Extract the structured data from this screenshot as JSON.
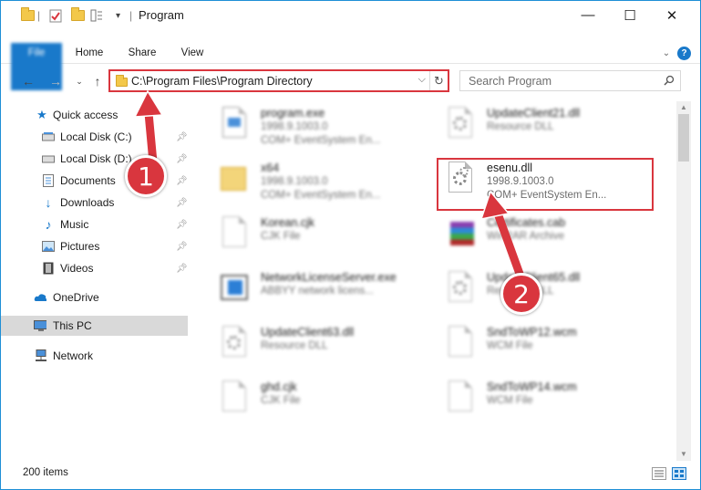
{
  "window": {
    "title": "Program",
    "controls": {
      "minimize": "—",
      "maximize": "☐",
      "close": "✕"
    }
  },
  "ribbon": {
    "tabs": [
      {
        "label": "File"
      },
      {
        "label": "Home"
      },
      {
        "label": "Share"
      },
      {
        "label": "View"
      }
    ],
    "help": "?"
  },
  "address": {
    "path": "C:\\Program Files\\Program Directory",
    "refresh": "↻",
    "dropdown": "⌵"
  },
  "search": {
    "placeholder": "Search Program"
  },
  "sidebar": {
    "items": [
      {
        "label": "Quick access",
        "icon": "star-icon",
        "pinned": false
      },
      {
        "label": "Local Disk (C:)",
        "icon": "disk-icon",
        "pinned": true
      },
      {
        "label": "Local Disk (D:)",
        "icon": "disk-icon",
        "pinned": true
      },
      {
        "label": "Documents",
        "icon": "documents-icon",
        "pinned": true
      },
      {
        "label": "Downloads",
        "icon": "download-icon",
        "pinned": true
      },
      {
        "label": "Music",
        "icon": "music-icon",
        "pinned": true
      },
      {
        "label": "Pictures",
        "icon": "pictures-icon",
        "pinned": true
      },
      {
        "label": "Videos",
        "icon": "videos-icon",
        "pinned": true
      },
      {
        "label": "OneDrive",
        "icon": "cloud-icon",
        "pinned": false
      },
      {
        "label": "This PC",
        "icon": "computer-icon",
        "pinned": false,
        "selected": true
      },
      {
        "label": "Network",
        "icon": "network-icon",
        "pinned": false
      }
    ]
  },
  "files": [
    {
      "name": "program.exe",
      "line1": "1998.9.1003.0",
      "line2": "COM+ EventSystem En...",
      "type": "exe"
    },
    {
      "name": "UpdateClient21.dll",
      "line1": "Resource DLL",
      "line2": "",
      "type": "dll"
    },
    {
      "name": "x64",
      "line1": "1998.9.1003.0",
      "line2": "COM+ EventSystem En...",
      "type": "folder"
    },
    {
      "name": "esenu.dll",
      "line1": "1998.9.1003.0",
      "line2": "COM+ EventSystem En...",
      "type": "dll",
      "highlighted": true
    },
    {
      "name": "Korean.cjk",
      "line1": "CJK File",
      "line2": "",
      "type": "blank"
    },
    {
      "name": "Certificates.cab",
      "line1": "WinRAR Archive",
      "line2": "",
      "type": "archive"
    },
    {
      "name": "NetworkLicenseServer.exe",
      "line1": "ABBYY network licens...",
      "line2": "",
      "type": "app"
    },
    {
      "name": "UpdateClient65.dll",
      "line1": "Resource DLL",
      "line2": "",
      "type": "dll"
    },
    {
      "name": "UpdateClient63.dll",
      "line1": "Resource DLL",
      "line2": "",
      "type": "dll"
    },
    {
      "name": "SndToWP12.wcm",
      "line1": "WCM File",
      "line2": "",
      "type": "blank"
    },
    {
      "name": "ghd.cjk",
      "line1": "CJK File",
      "line2": "",
      "type": "blank"
    },
    {
      "name": "SndToWP14.wcm",
      "line1": "WCM File",
      "line2": "",
      "type": "blank"
    }
  ],
  "status": {
    "count": "200 items"
  },
  "annotations": {
    "step1": "1",
    "step2": "2",
    "color": "#d9363e"
  }
}
